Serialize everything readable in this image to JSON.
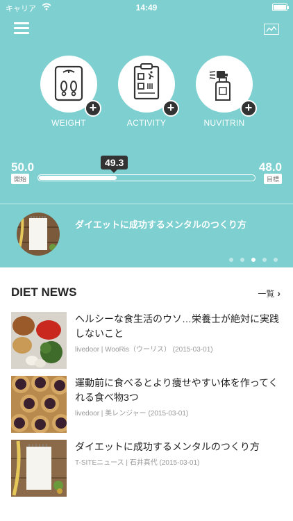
{
  "status_bar": {
    "carrier": "キャリア",
    "time": "14:49"
  },
  "header": {
    "menu_icon": "hamburger-menu-icon",
    "chart_icon": "line-chart-icon"
  },
  "actions": [
    {
      "label": "WEIGHT",
      "icon": "scale-footprints-icon"
    },
    {
      "label": "ACTIVITY",
      "icon": "clipboard-activity-icon"
    },
    {
      "label": "NUVITRIN",
      "icon": "spray-bottle-icon"
    }
  ],
  "progress": {
    "start_value": "50.0",
    "start_label": "開始",
    "end_value": "48.0",
    "end_label": "目標",
    "current_value": "49.3",
    "fill_fraction": 0.36
  },
  "feature": {
    "title": "ダイエットに成功するメンタルのつくり方",
    "page_count": 5,
    "active_page": 3
  },
  "news": {
    "heading": "DIET NEWS",
    "more_label": "一覧",
    "items": [
      {
        "title": "ヘルシーな食生活のウソ…栄養士が絶対に実践しないこと",
        "meta": "livedoor | WooRis（ウーリス） (2015-03-01)"
      },
      {
        "title": "運動前に食べるとより痩せやすい体を作ってくれる食べ物3つ",
        "meta": "livedoor | 美レンジャー (2015-03-01)"
      },
      {
        "title": "ダイエットに成功するメンタルのつくり方",
        "meta": "T-SITEニュース | 石井真代 (2015-03-01)"
      }
    ]
  },
  "colors": {
    "teal": "#7dcfd0",
    "accent_dark": "#333333"
  }
}
